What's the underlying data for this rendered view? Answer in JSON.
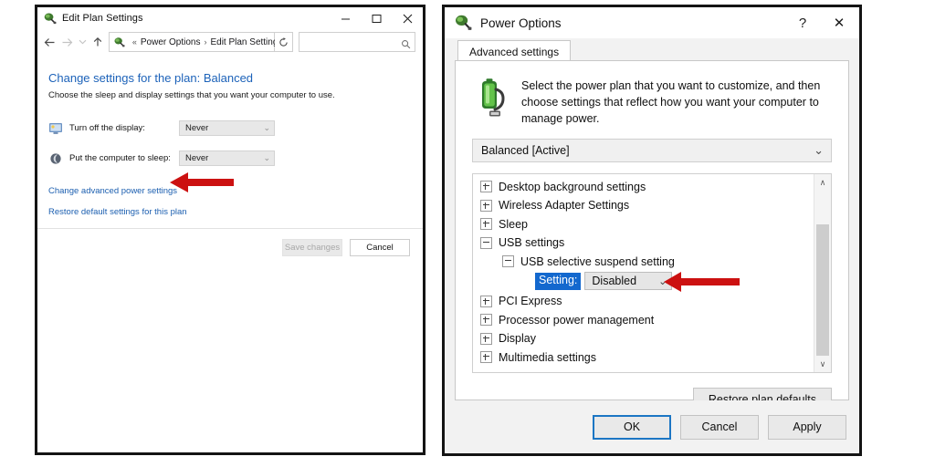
{
  "left_window": {
    "title": "Edit Plan Settings",
    "title_icon": "power-plug-icon",
    "caption": {
      "minimize": "minimize-icon",
      "maximize": "maximize-icon",
      "close": "close-icon"
    },
    "nav": {
      "back": "back-arrow-icon",
      "forward": "forward-arrow-icon",
      "recent": "chevron-down-icon",
      "up": "up-arrow-icon",
      "breadcrumb_icon": "power-plug-icon",
      "breadcrumb_chevron": "«",
      "breadcrumb": [
        "Power Options",
        "Edit Plan Settings"
      ],
      "breadcrumb_separator": "›",
      "dropdown_caret": "⌄",
      "refresh": "refresh-icon",
      "search_placeholder": "",
      "search_value": "",
      "search_icon": "search-icon"
    },
    "heading": "Change settings for the plan: Balanced",
    "subheading": "Choose the sleep and display settings that you want your computer to use.",
    "settings": [
      {
        "icon": "monitor-icon",
        "label": "Turn off the display:",
        "value": "Never"
      },
      {
        "icon": "moon-icon",
        "label": "Put the computer to sleep:",
        "value": "Never"
      }
    ],
    "links": [
      "Change advanced power settings",
      "Restore default settings for this plan"
    ],
    "buttons": {
      "save": "Save changes",
      "cancel": "Cancel"
    },
    "annotation_arrow": "red-left-arrow"
  },
  "right_window": {
    "title": "Power Options",
    "title_icon": "power-plug-icon",
    "caption": {
      "help": "?",
      "close": "✕"
    },
    "tab": "Advanced settings",
    "intro_icon": "battery-plug-icon",
    "intro_text": "Select the power plan that you want to customize, and then choose settings that reflect how you want your computer to manage power.",
    "plan_select": {
      "value": "Balanced [Active]",
      "caret": "⌄"
    },
    "tree": [
      {
        "level": 1,
        "state": "collapsed",
        "label": "Desktop background settings"
      },
      {
        "level": 1,
        "state": "collapsed",
        "label": "Wireless Adapter Settings"
      },
      {
        "level": 1,
        "state": "collapsed",
        "label": "Sleep"
      },
      {
        "level": 1,
        "state": "expanded",
        "label": "USB settings"
      },
      {
        "level": 2,
        "state": "expanded",
        "label": "USB selective suspend setting"
      },
      {
        "level": 3,
        "state": "setting",
        "label": "Setting:",
        "value": "Disabled"
      },
      {
        "level": 1,
        "state": "collapsed",
        "label": "PCI Express"
      },
      {
        "level": 1,
        "state": "collapsed",
        "label": "Processor power management"
      },
      {
        "level": 1,
        "state": "collapsed",
        "label": "Display"
      },
      {
        "level": 1,
        "state": "collapsed",
        "label": "Multimedia settings"
      }
    ],
    "scrollbar": {
      "up_arrow": "∧",
      "down_arrow": "∨"
    },
    "restore_button": "Restore plan defaults",
    "footer_buttons": {
      "ok": "OK",
      "cancel": "Cancel",
      "apply": "Apply"
    },
    "annotation_arrow": "red-left-arrow"
  },
  "colors": {
    "accent_blue": "#1c62b9",
    "selection_blue": "#1368ce",
    "arrow_red": "#cc1111",
    "window_border": "#141414",
    "dialog_bg": "#f2f2f2"
  }
}
